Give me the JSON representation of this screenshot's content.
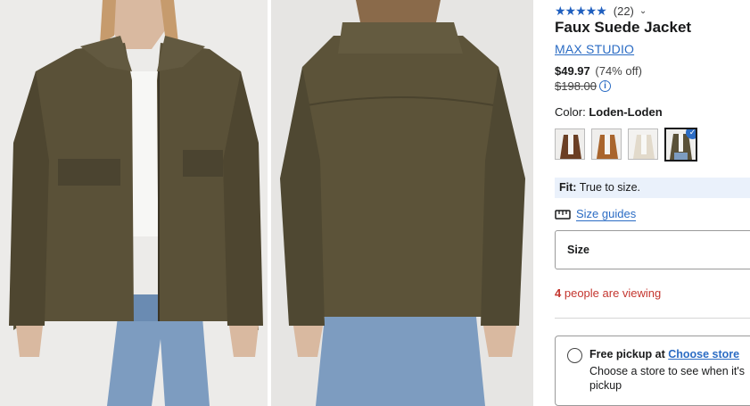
{
  "product": {
    "rating_stars": "★★★★★",
    "review_count": "(22)",
    "rating_chevron": "⌄",
    "title": "Faux Suede Jacket",
    "brand": "MAX STUDIO",
    "sale_price": "$49.97",
    "discount": "(74% off)",
    "original_price": "$198.00",
    "info_icon": "i",
    "color_label": "Color:",
    "color_value": "Loden-Loden",
    "swatches": [
      {
        "name": "brown",
        "color": "#6b3f24"
      },
      {
        "name": "cognac",
        "color": "#a9652d"
      },
      {
        "name": "cream",
        "color": "#e7e0d4"
      },
      {
        "name": "loden",
        "color": "#5a5138",
        "selected": true
      }
    ],
    "check_icon": "✓",
    "fit_label": "Fit:",
    "fit_value": "True to size.",
    "size_guides": "Size guides",
    "size_label": "Size",
    "viewers_count": "4",
    "viewers_text": "people are viewing",
    "pickup_title": "Free pickup at",
    "pickup_link": "Choose store",
    "pickup_desc": "Choose a store to see when it's pickup"
  },
  "colors": {
    "accent": "#2b6cc4",
    "alert": "#c4362f",
    "fit_bg": "#eaf1fb",
    "jacket": "#5a5138"
  },
  "icons": {
    "ruler": "ruler-icon",
    "star": "star-icon"
  }
}
